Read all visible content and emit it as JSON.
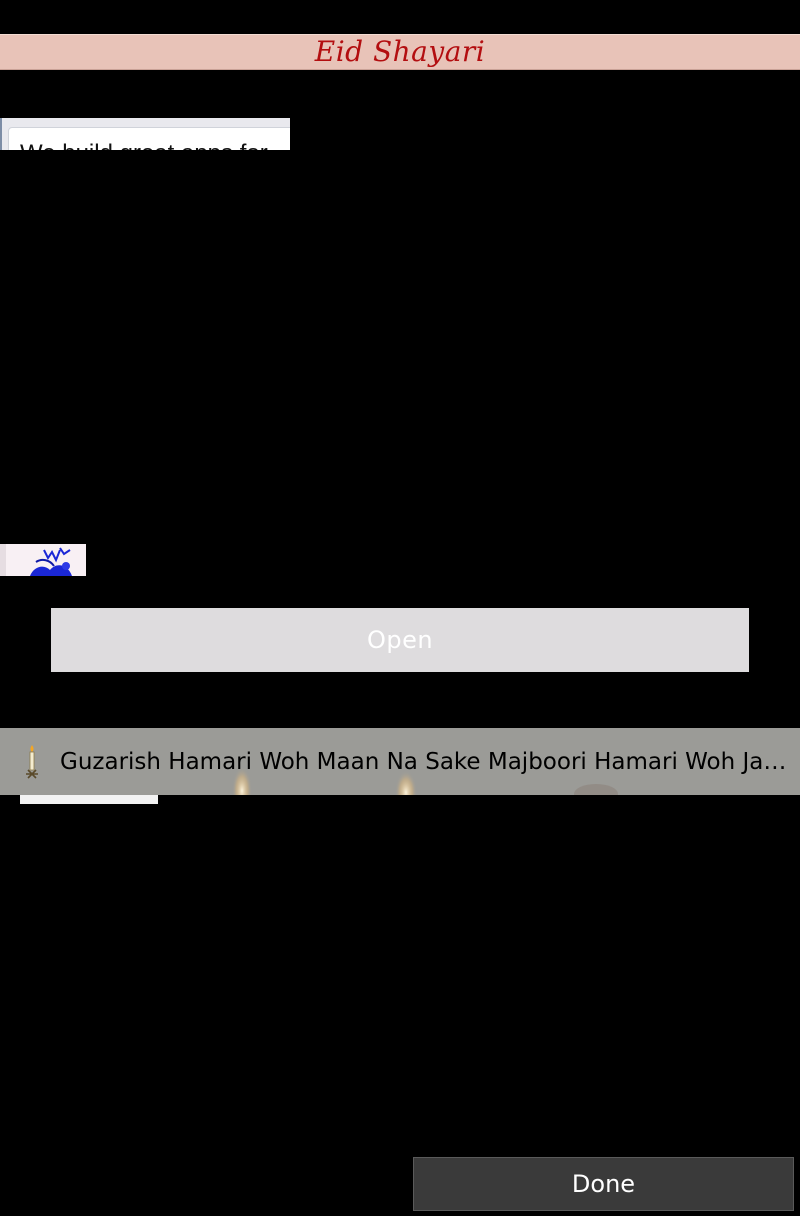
{
  "header": {
    "title": "Eid Shayari"
  },
  "ad": {
    "text": "We build great apps for"
  },
  "actions": {
    "open_label": "Open",
    "done_label": "Done"
  },
  "list": {
    "items": [
      {
        "icon": "candle-icon",
        "text": "Guzarish Hamari Woh Maan Na Sake Majboori Hamari Woh Jaan Na Sake..."
      }
    ]
  },
  "colors": {
    "background": "#000000",
    "title_bar": "#e8c3b8",
    "title_text": "#b30e10",
    "open_button": "#dedcde",
    "list_row": "#9b9b97",
    "done_button": "#3a3a3a"
  }
}
